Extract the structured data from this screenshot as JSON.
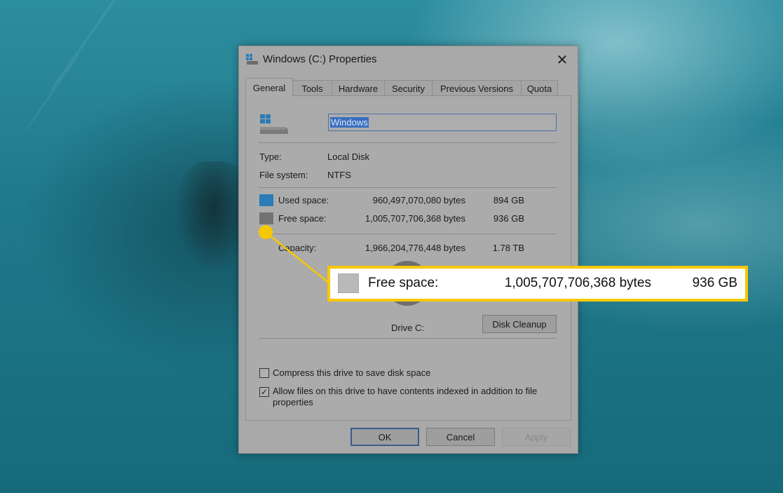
{
  "window": {
    "title": "Windows (C:) Properties",
    "close_glyph": "✕"
  },
  "tabs": [
    {
      "label": "General",
      "active": true
    },
    {
      "label": "Tools",
      "active": false
    },
    {
      "label": "Hardware",
      "active": false
    },
    {
      "label": "Security",
      "active": false
    },
    {
      "label": "Previous Versions",
      "active": false
    },
    {
      "label": "Quota",
      "active": false
    }
  ],
  "drive": {
    "name": "Windows",
    "icon": "drive-icon"
  },
  "info": {
    "type_label": "Type:",
    "type_value": "Local Disk",
    "fs_label": "File system:",
    "fs_value": "NTFS"
  },
  "space": {
    "used": {
      "label": "Used space:",
      "bytes": "960,497,070,080 bytes",
      "size": "894 GB",
      "color": "#2b7bb5"
    },
    "free": {
      "label": "Free space:",
      "bytes": "1,005,707,706,368 bytes",
      "size": "936 GB",
      "color": "#737373"
    },
    "capacity": {
      "label": "Capacity:",
      "bytes": "1,966,204,776,448 bytes",
      "size": "1.78 TB"
    }
  },
  "drive_label": "Drive C:",
  "disk_cleanup_label": "Disk Cleanup",
  "options": {
    "compress": {
      "label": "Compress this drive to save disk space",
      "checked": false
    },
    "index": {
      "label_line1": "Allow files on this drive to have contents indexed in addition to file",
      "label_line2": "properties",
      "checked": true,
      "check_glyph": "✓"
    }
  },
  "buttons": {
    "ok": "OK",
    "cancel": "Cancel",
    "apply": "Apply"
  },
  "callout": {
    "label": "Free space:",
    "bytes": "1,005,707,706,368 bytes",
    "size": "936 GB",
    "color": "#f6c800"
  }
}
